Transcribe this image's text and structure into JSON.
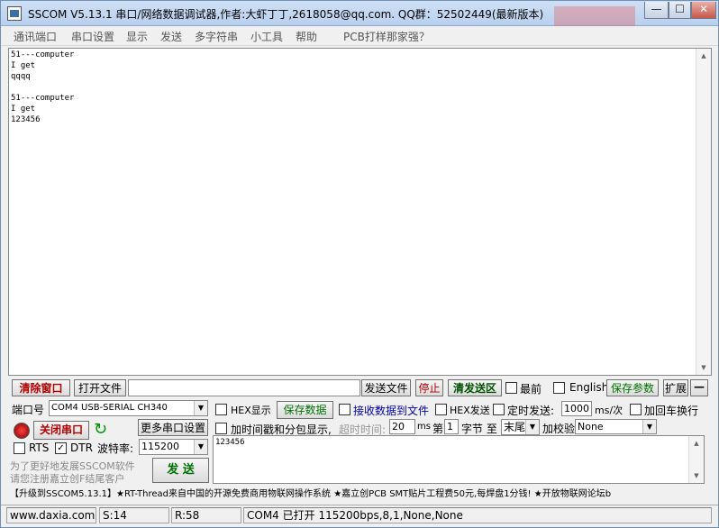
{
  "window": {
    "title": "SSCOM V5.13.1 串口/网络数据调试器,作者:大虾丁丁,2618058@qq.com. QQ群：52502449(最新版本)",
    "min_label": "—",
    "max_label": "☐",
    "close_label": "✕"
  },
  "menu": [
    "通讯端口",
    "串口设置",
    "显示",
    "发送",
    "多字符串",
    "小工具",
    "帮助",
    "PCB打样那家强？"
  ],
  "receive": {
    "text": "51---computer\nI get\nqqqq\n\n51---computer\nI get\n123456"
  },
  "toolbar": {
    "clear_label": "清除窗口",
    "open_file_label": "打开文件",
    "file_path": "",
    "send_file_label": "发送文件",
    "stop_label": "停止",
    "clear_send_label": "清发送区",
    "top_label": "最前",
    "english_label": "English",
    "save_params_label": "保存参数",
    "expand_label": "扩展",
    "collapse_label": "—"
  },
  "port": {
    "port_label": "端口号",
    "port_value": "COM4 USB-SERIAL CH340",
    "hex_display_label": "HEX显示",
    "save_data_label": "保存数据",
    "recv_to_file_label": "接收数据到文件",
    "hex_send_label": "HEX发送",
    "timed_send_label": "定时发送:",
    "interval_value": "1000",
    "interval_unit": "ms/次",
    "add_newline_label": "加回车换行",
    "close_port_label": "关闭串口",
    "more_settings_label": "更多串口设置",
    "timestamp_label": "加时间戳和分包显示,",
    "timeout_label": "超时时间:",
    "timeout_value": "20",
    "timeout_unit": "ms",
    "byte_prefix": "第",
    "byte_start": "1",
    "byte_mid": "字节 至",
    "byte_end": "末尾",
    "checksum_label": "加校验",
    "checksum_value": "None",
    "rts_label": "RTS",
    "dtr_label": "DTR",
    "baud_label": "波特率:",
    "baud_value": "115200",
    "send_text": "123456",
    "send_label": "发 送",
    "promo_line1": "为了更好地发展SSCOM软件",
    "promo_line2": "请您注册嘉立创F结尾客户"
  },
  "ticker": "【升级到SSCOM5.13.1】★RT-Thread来自中国的开源免费商用物联网操作系统 ★嘉立创PCB SMT贴片工程费50元,每焊盘1分钱! ★开放物联网论坛b",
  "status": {
    "site": "www.daxia.com",
    "sent": "S:14",
    "received": "R:58",
    "port_state": "COM4 已打开  115200bps,8,1,None,None"
  },
  "colors": {
    "accent_red": "#b00000",
    "green_text": "#007000",
    "blue_text": "#0000b0"
  }
}
